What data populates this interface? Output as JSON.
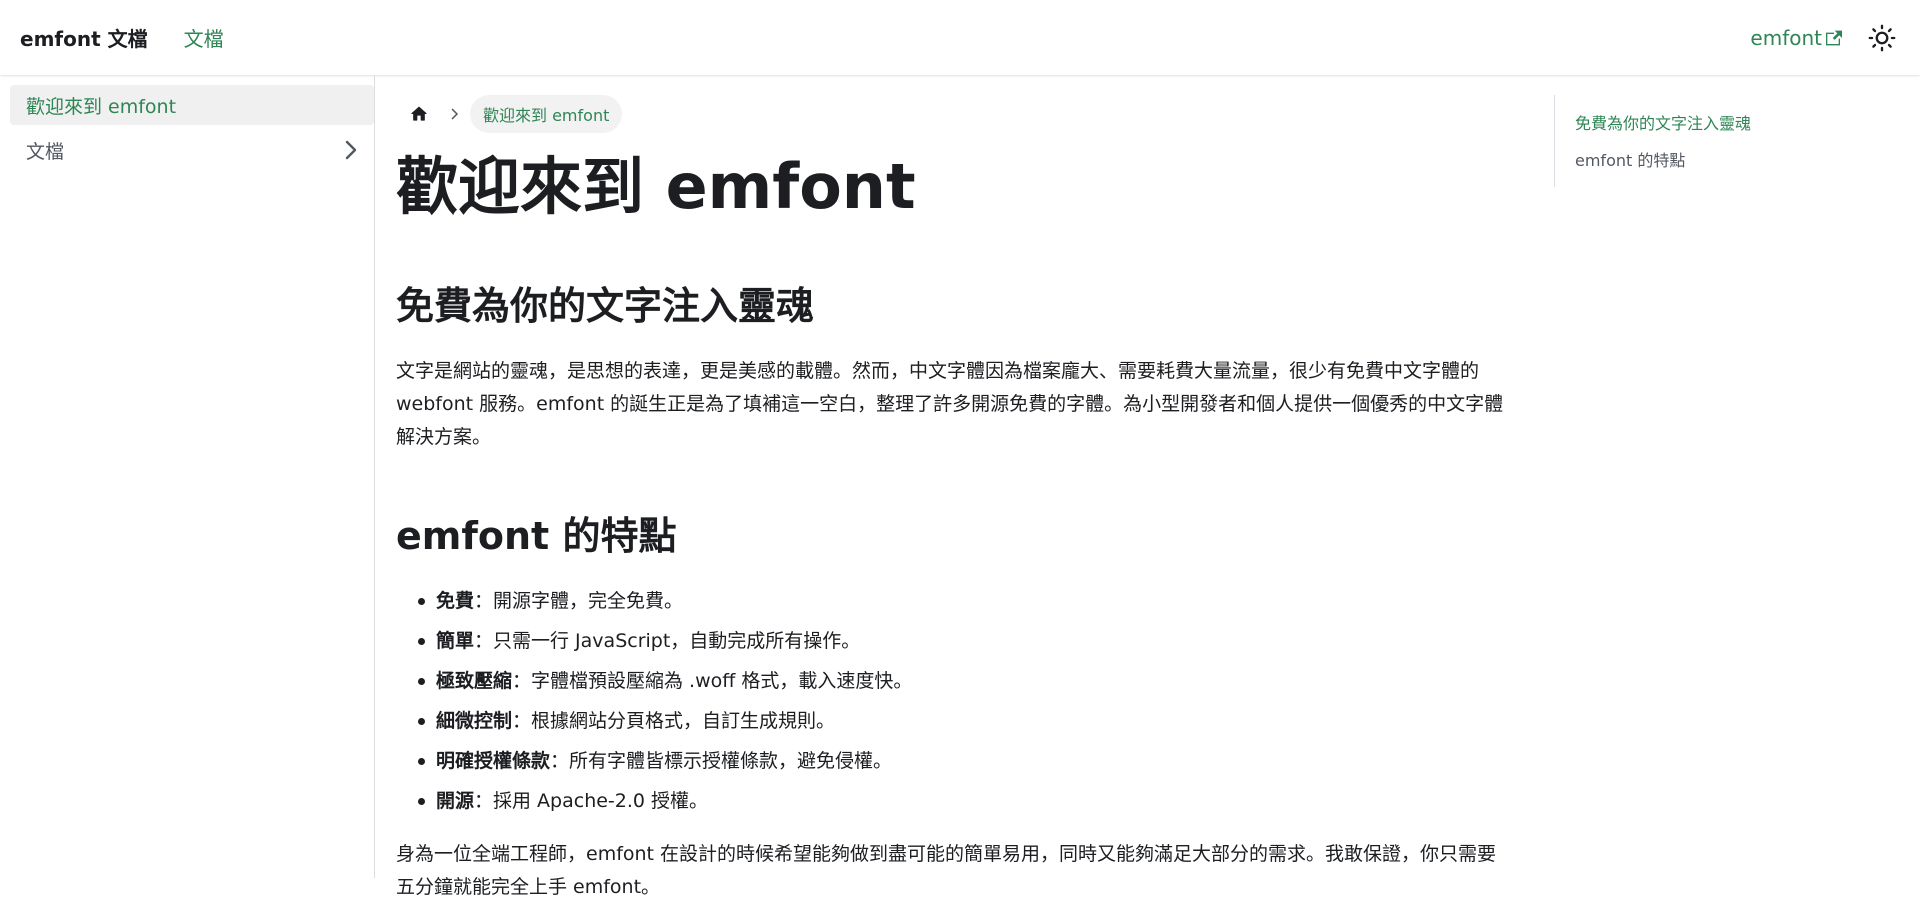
{
  "navbar": {
    "brand": "emfont 文檔",
    "docs_link": "文檔",
    "external_link": "emfont",
    "icons": {
      "external": "external-link-icon",
      "theme": "sun-icon"
    }
  },
  "sidebar": {
    "items": [
      {
        "label": "歡迎來到 emfont",
        "active": true
      },
      {
        "label": "文檔",
        "expandable": true
      }
    ]
  },
  "breadcrumbs": {
    "home_icon": "home-icon",
    "current": "歡迎來到 emfont"
  },
  "content": {
    "title": "歡迎來到 emfont",
    "section1": {
      "heading": "免費為你的文字注入靈魂",
      "paragraph": "文字是網站的靈魂，是思想的表達，更是美感的載體。然而，中文字體因為檔案龐大、需要耗費大量流量，很少有免費中文字體的 webfont 服務。emfont 的誕生正是為了填補這一空白，整理了許多開源免費的字體。為小型開發者和個人提供一個優秀的中文字體解決方案。"
    },
    "section2": {
      "heading": "emfont 的特點",
      "features": [
        {
          "term": "免費",
          "desc": "：開源字體，完全免費。"
        },
        {
          "term": "簡單",
          "desc": "：只需一行 JavaScript，自動完成所有操作。"
        },
        {
          "term": "極致壓縮",
          "desc": "：字體檔預設壓縮為 .woff 格式，載入速度快。"
        },
        {
          "term": "細微控制",
          "desc": "：根據網站分頁格式，自訂生成規則。"
        },
        {
          "term": "明確授權條款",
          "desc": "：所有字體皆標示授權條款，避免侵權。"
        },
        {
          "term": "開源",
          "desc": "：採用 Apache-2.0 授權。"
        }
      ],
      "closing": "身為一位全端工程師，emfont 在設計的時候希望能夠做到盡可能的簡單易用，同時又能夠滿足大部分的需求。我敢保證，你只需要五分鐘就能完全上手 emfont。"
    }
  },
  "toc": {
    "items": [
      {
        "label": "免費為你的文字注入靈魂",
        "active": true
      },
      {
        "label": "emfont 的特點",
        "active": false
      }
    ]
  },
  "colors": {
    "accent": "#2e8555",
    "text": "#1c1e21",
    "muted": "#525860",
    "active_bg": "#f0f0f0",
    "border": "#dadde1"
  }
}
